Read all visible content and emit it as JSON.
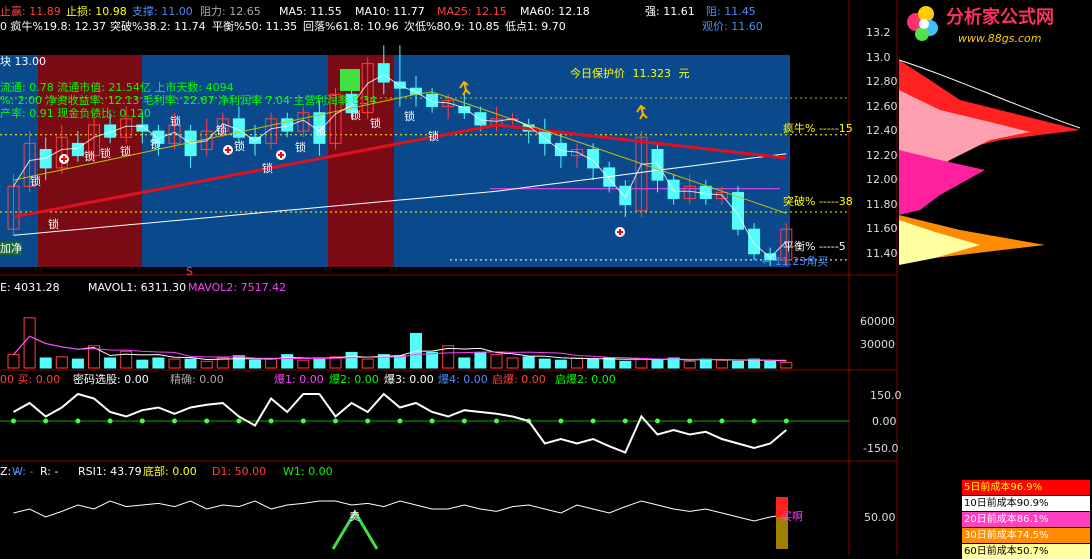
{
  "colors": {
    "up": "#ff4040",
    "down": "#54fcfc",
    "ma5": "#ffffff",
    "ma10": "#ffff00",
    "ma25": "#ff40ff",
    "ma60": "#00ff00",
    "blue_bg": "#0a4a8c",
    "red_bg": "#7a0a14",
    "grid": "#8b0000"
  },
  "header": {
    "row1": [
      {
        "text": "止赢: 11.89",
        "color": "#ff4040"
      },
      {
        "text": "止损: 10.98",
        "color": "#ffff00"
      },
      {
        "text": "支撑: 11.00",
        "color": "#4a8cff"
      },
      {
        "text": "阻力: 12.65",
        "color": "#aaaaaa"
      },
      {
        "text": "MA5: 11.55",
        "color": "#ffffff"
      },
      {
        "text": "MA10: 11.77",
        "color": "#ffffff"
      },
      {
        "text": "MA25: 12.15",
        "color": "#ff4040"
      },
      {
        "text": "MA60: 12.18",
        "color": "#ffffff"
      },
      {
        "text": "强: 11.61",
        "color": "#ffffff"
      },
      {
        "text": "阻: 11.45",
        "color": "#4a8cff"
      }
    ],
    "row2": [
      {
        "text": "0  疯牛%19.8: 12.37",
        "color": "#ffffff"
      },
      {
        "text": "突破%38.2: 11.74",
        "color": "#ffffff"
      },
      {
        "text": "平衡%50: 11.35",
        "color": "#ffffff"
      },
      {
        "text": "回落%61.8: 10.96",
        "color": "#ffffff"
      },
      {
        "text": "次低%80.9: 10.85",
        "color": "#ffffff"
      },
      {
        "text": "低点1: 9.70",
        "color": "#ffffff"
      },
      {
        "text": "观价: 11.60",
        "color": "#4a8cff"
      }
    ]
  },
  "main_panel": {
    "overlay_lines": [
      {
        "text": "块  13.00",
        "color": "#ffffff"
      },
      {
        "text": "流通: 0.78 流通市值: 21.54亿 上市天数: 4094",
        "color": "#00ff00"
      },
      {
        "text": "%: 2.00 净资收益率: 12.13 毛利率: 22.67 净利润率 7.04 主营利润率 8.34",
        "color": "#00ff00"
      },
      {
        "text": "产率: 0.91 现金负债比: 0.120",
        "color": "#00ff00"
      }
    ],
    "protect_price_label": "今日保护价",
    "protect_price_value": "11.323",
    "protect_price_unit": "元",
    "lock_label": "锁",
    "level_labels": [
      {
        "text": "疯牛% -----",
        "value": "15"
      },
      {
        "text": "突破% -----",
        "value": "38"
      },
      {
        "text": "平衡% -----",
        "value": "5"
      }
    ],
    "buy_label": "← 11.23角买",
    "left_tag": "加净",
    "s_marker": "S",
    "y_axis": [
      "13.2",
      "13.0",
      "12.80",
      "12.60",
      "12.40",
      "12.20",
      "12.00",
      "11.80",
      "11.60",
      "11.40"
    ]
  },
  "volume_panel": {
    "header": [
      {
        "text": "E: 4031.28",
        "color": "#ffffff"
      },
      {
        "text": "MAVOL1: 6311.30",
        "color": "#ffffff"
      },
      {
        "text": "MAVOL2: 7517.42",
        "color": "#ff40ff"
      }
    ],
    "y_axis": [
      "60000",
      "30000"
    ]
  },
  "signal_panel": {
    "header": [
      {
        "text": "00  买: 0.00",
        "color": "#ff4040"
      },
      {
        "text": "密码选股: 0.00",
        "color": "#ffffff"
      },
      {
        "text": "精确: 0.00",
        "color": "#aaaaaa"
      },
      {
        "text": "爆1: 0.00",
        "color": "#ff40ff"
      },
      {
        "text": "爆2: 0.00",
        "color": "#00ff00"
      },
      {
        "text": "爆3: 0.00",
        "color": "#ffffff"
      },
      {
        "text": "爆4: 0.00",
        "color": "#4a8cff"
      },
      {
        "text": "启爆: 0.00",
        "color": "#ff4040"
      },
      {
        "text": "启爆2: 0.00",
        "color": "#00ff00"
      }
    ],
    "y_axis": [
      "150.0",
      "0.00",
      "-150.0"
    ]
  },
  "rsi_panel": {
    "header": [
      {
        "text": "Z: -",
        "color": "#ffffff"
      },
      {
        "text": "W: -",
        "color": "#4a8cff"
      },
      {
        "text": "R: -",
        "color": "#ffffff"
      },
      {
        "text": "RSI1: 43.79",
        "color": "#ffffff"
      },
      {
        "text": "底部: 0.00",
        "color": "#ffff00"
      },
      {
        "text": "D1: 50.00",
        "color": "#ff4040"
      },
      {
        "text": "W1: 0.00",
        "color": "#00ff00"
      }
    ],
    "sell_label": "卖",
    "buy_label": "买啊",
    "y_axis": [
      "50.00"
    ]
  },
  "cost_legend": [
    {
      "text": "5日前成本96.9%",
      "bg": "#ff0000",
      "fg": "#ffff00"
    },
    {
      "text": "10日前成本90.9%",
      "bg": "#ffffff",
      "fg": "#000000"
    },
    {
      "text": "20日前成本86.1%",
      "bg": "#ff40c0",
      "fg": "#ffffff"
    },
    {
      "text": "30日前成本74.5%",
      "bg": "#ff8c00",
      "fg": "#ffffff"
    },
    {
      "text": "60日前成本50.7%",
      "bg": "#ffffa0",
      "fg": "#000000"
    }
  ],
  "logo": {
    "title": "分析家公式网",
    "url": "www.88gs.com"
  }
}
